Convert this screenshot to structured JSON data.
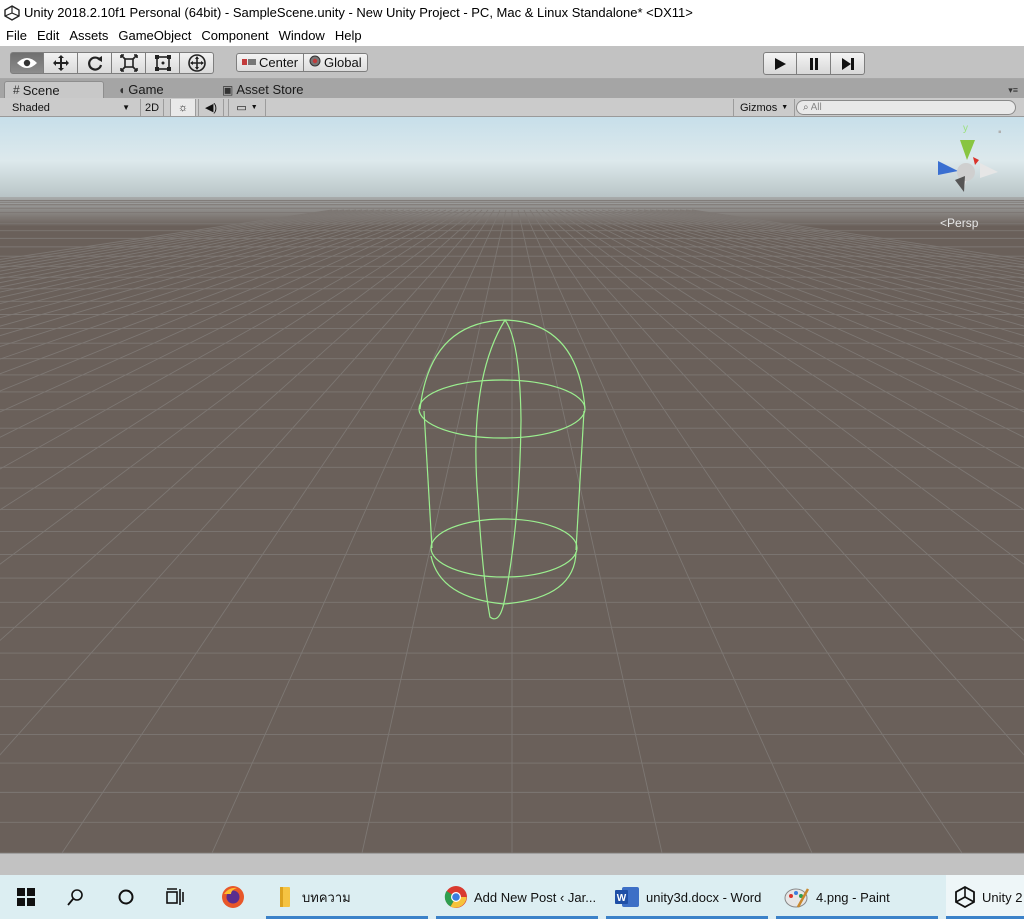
{
  "window": {
    "title": "Unity 2018.2.10f1 Personal (64bit) - SampleScene.unity - New Unity Project - PC, Mac & Linux Standalone* <DX11>"
  },
  "menu": [
    "File",
    "Edit",
    "Assets",
    "GameObject",
    "Component",
    "Window",
    "Help"
  ],
  "toolbar": {
    "tools": [
      "hand-tool",
      "move-tool",
      "rotate-tool",
      "scale-tool",
      "rect-tool",
      "transform-tool"
    ],
    "pivot_label": "Center",
    "space_label": "Global",
    "playback": [
      "play",
      "pause",
      "step"
    ]
  },
  "tabs": [
    {
      "label": "Scene",
      "active": true
    },
    {
      "label": "Game",
      "active": false
    },
    {
      "label": "Asset Store",
      "active": false
    }
  ],
  "scene_toolbar": {
    "shading_mode": "Shaded",
    "mode_2d": "2D",
    "gizmos_label": "Gizmos",
    "search_placeholder": "All"
  },
  "scene": {
    "gizmo_axis_label": "y",
    "projection_label": "Persp",
    "sky_color": "#cfe2ea",
    "ground_color": "#6a605a",
    "collider_color": "#9bef8f"
  },
  "taskbar": {
    "items": [
      {
        "label": "บทความ",
        "icon": "folder-icon"
      },
      {
        "label": "Add New Post ‹ Jar...",
        "icon": "chrome-icon"
      },
      {
        "label": "unity3d.docx - Word",
        "icon": "word-icon"
      },
      {
        "label": "4.png - Paint",
        "icon": "paint-icon"
      },
      {
        "label": "Unity 2",
        "icon": "unity-icon"
      }
    ]
  }
}
